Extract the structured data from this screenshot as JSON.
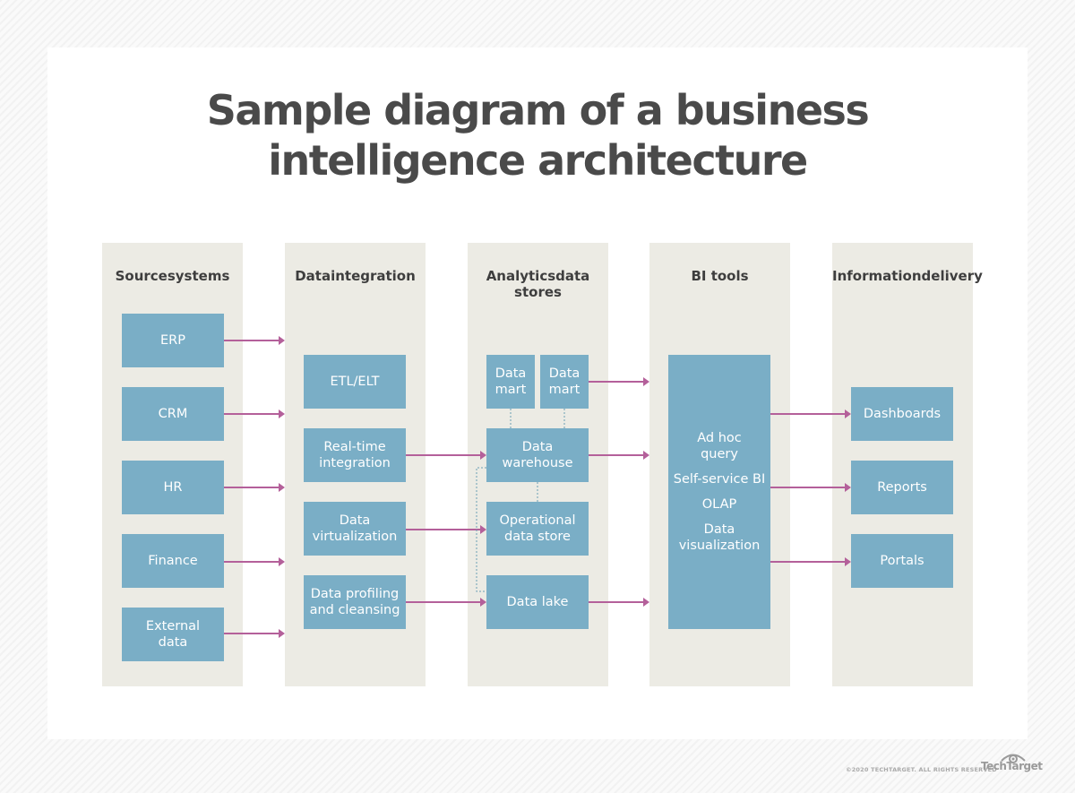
{
  "title_line1": "Sample diagram of a business",
  "title_line2": "intelligence architecture",
  "columns": [
    {
      "head": "Source\nsystems",
      "items": [
        "ERP",
        "CRM",
        "HR",
        "Finance",
        "External\ndata"
      ]
    },
    {
      "head": "Data\nintegration",
      "items": [
        "ETL/ELT",
        "Real-time\nintegration",
        "Data\nvirtualization",
        "Data profiling\nand cleansing"
      ]
    },
    {
      "head": "Analytics\ndata stores",
      "items": [
        "Data\nmart",
        "Data\nmart",
        "Data\nwarehouse",
        "Operational\ndata store",
        "Data lake"
      ]
    },
    {
      "head": "BI tools",
      "items": [
        "Ad hoc\nquery",
        "Self-service BI",
        "OLAP",
        "Data\nvisualization"
      ]
    },
    {
      "head": "Information\ndelivery",
      "items": [
        "Dashboards",
        "Reports",
        "Portals"
      ]
    }
  ],
  "colors": {
    "box": "#7aaec6",
    "arrow": "#b4609a",
    "column": "#ecebe4",
    "title": "#4a4a4a"
  },
  "footer": {
    "copyright": "©2020 TECHTARGET. ALL RIGHTS RESERVED",
    "brand": "TechTarget"
  }
}
